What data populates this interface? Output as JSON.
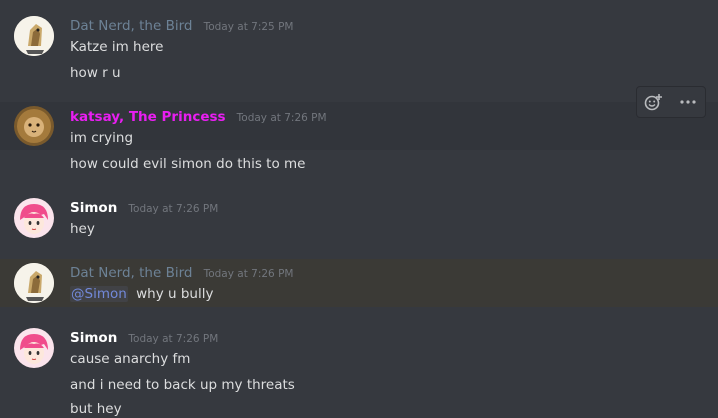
{
  "colors": {
    "background": "#36393f",
    "dat_nerd_name": "#6d8296",
    "katsay_name": "#e91ef2",
    "simon_name": "#ffffff",
    "mention": "#7289da",
    "message_text": "#dcddde",
    "timestamp": "#72767d"
  },
  "messages": [
    {
      "username": "Dat Nerd, the Bird",
      "timestamp": "Today at 7:25 PM",
      "lines": [
        "Katze im here",
        "how r u"
      ]
    },
    {
      "username": "katsay, The Princess",
      "timestamp": "Today at 7:26 PM",
      "lines": [
        "im crying",
        "how could evil simon do this to me"
      ]
    },
    {
      "username": "Simon",
      "timestamp": "Today at 7:26 PM",
      "lines": [
        "hey"
      ]
    },
    {
      "username": "Dat Nerd, the Bird",
      "timestamp": "Today at 7:26 PM",
      "mention": "@Simon",
      "lines": [
        "why u bully"
      ]
    },
    {
      "username": "Simon",
      "timestamp": "Today at 7:26 PM",
      "lines": [
        "cause anarchy fm",
        "and i need to back up my threats",
        "but hey"
      ]
    }
  ],
  "toolbar": {
    "icons": [
      "add-reaction-icon",
      "more-options-icon"
    ]
  }
}
